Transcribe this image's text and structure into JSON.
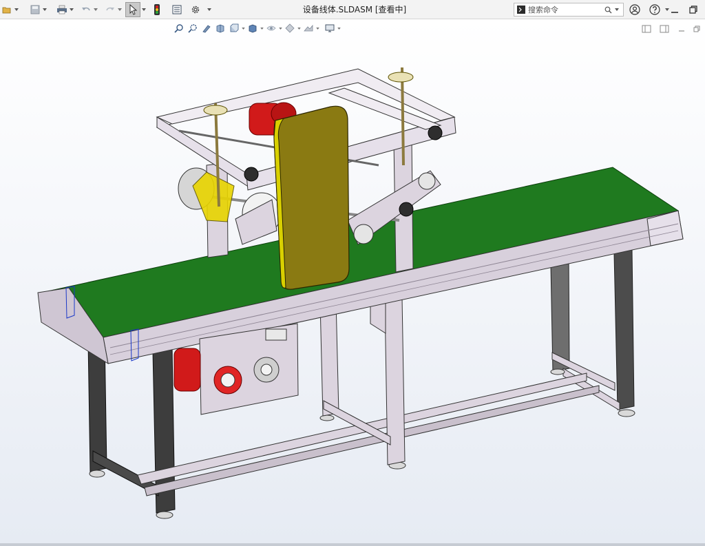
{
  "window": {
    "title": "设备线体.SLDASM [查看中]"
  },
  "toolbar": {
    "items": [
      "folder-open-icon",
      "save-icon",
      "print-icon",
      "undo-icon",
      "redo-icon",
      "select-icon",
      "rebuild-icon",
      "file-properties-icon",
      "options-icon"
    ]
  },
  "search": {
    "placeholder": "搜索命令"
  },
  "hud_toolbar": {
    "items": [
      "zoom-to-fit-icon",
      "zoom-to-area-icon",
      "previous-view-icon",
      "section-view-icon",
      "view-orientation-icon",
      "display-style-icon",
      "hide-show-items-icon",
      "edit-appearance-icon",
      "apply-scene-icon",
      "view-settings-icon"
    ]
  },
  "colors": {
    "belt": "#1f7a1f",
    "frame": "#d8d0dc",
    "motor": "#d11a1a",
    "cover": "#8a7a12",
    "leg_dark": "#3d3d3d"
  }
}
